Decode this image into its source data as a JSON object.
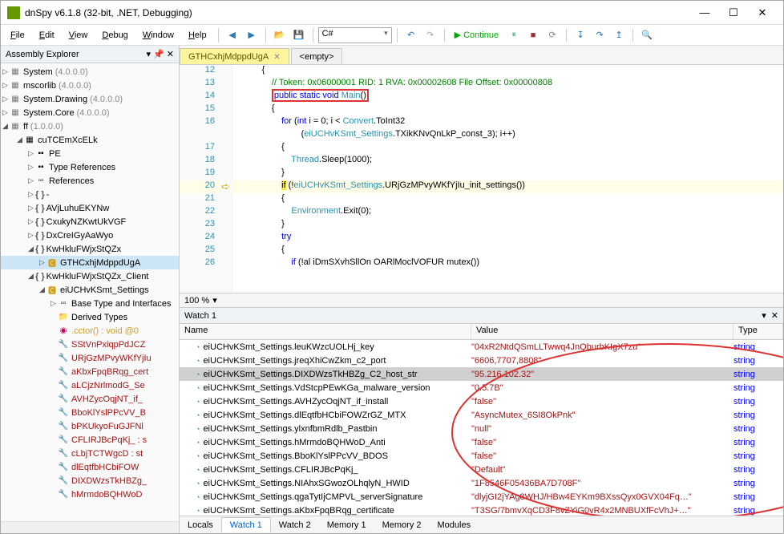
{
  "window": {
    "title": "dnSpy v6.1.8 (32-bit, .NET, Debugging)"
  },
  "menu": {
    "file": "File",
    "edit": "Edit",
    "view": "View",
    "debug": "Debug",
    "window": "Window",
    "help": "Help"
  },
  "toolbar": {
    "language": "C#",
    "continue": "Continue"
  },
  "explorer": {
    "title": "Assembly Explorer",
    "roots": [
      {
        "name": "System",
        "ver": "(4.0.0.0)"
      },
      {
        "name": "mscorlib",
        "ver": "(4.0.0.0)"
      },
      {
        "name": "System.Drawing",
        "ver": "(4.0.0.0)"
      },
      {
        "name": "System.Core",
        "ver": "(4.0.0.0)"
      },
      {
        "name": "ff",
        "ver": "(1.0.0.0)"
      }
    ],
    "sub": [
      {
        "name": "cuTCEmXcELk"
      },
      {
        "name": "PE",
        "icon": "pe"
      },
      {
        "name": "Type References",
        "icon": "pe"
      },
      {
        "name": "References",
        "icon": "ref"
      },
      {
        "name": "{ } -"
      },
      {
        "name": "{ } AVjLuhuEKYNw"
      },
      {
        "name": "{ } CxukyNZKwtUkVGF"
      },
      {
        "name": "{ } DxCreIGyAaWyo"
      },
      {
        "name": "{ } KwHkluFWjxStQZx"
      },
      {
        "name": "GTHCxhjMdppdUgA",
        "icon": "cls",
        "selected": true
      },
      {
        "name": "{ } KwHkluFWjxStQZx_Client"
      },
      {
        "name": "eiUCHvKSmt_Settings",
        "icon": "cls"
      },
      {
        "name": "Base Type and Interfaces",
        "icon": "ref"
      },
      {
        "name": "Derived Types",
        "icon": "folder"
      },
      {
        "name": ".cctor() : void @0",
        "icon": "method"
      },
      {
        "name": "SStVnPxiqpPdJCZ",
        "icon": "prop"
      },
      {
        "name": "URjGzMPvyWKfYjIu",
        "icon": "prop"
      },
      {
        "name": "aKbxFpqBRqg_cert",
        "icon": "prop"
      },
      {
        "name": "aLCjzNrlmodG_Se",
        "icon": "prop"
      },
      {
        "name": "AVHZycOqjNT_if_",
        "icon": "prop"
      },
      {
        "name": "BboKlYslPPcVV_B",
        "icon": "prop"
      },
      {
        "name": "bPKUkyoFuGJFNl",
        "icon": "prop"
      },
      {
        "name": "CFLIRJBcPqKj_ : s",
        "icon": "prop"
      },
      {
        "name": "cLbjTCTWgcD : st",
        "icon": "prop"
      },
      {
        "name": "dlEqtfbHCbiFOW",
        "icon": "prop"
      },
      {
        "name": "DIXDWzsTkHBZg_",
        "icon": "prop"
      },
      {
        "name": "hMrmdoBQHWoD",
        "icon": "prop"
      }
    ]
  },
  "editor": {
    "tabs": [
      {
        "label": "GTHCxhjMdppdUgA",
        "active": true
      },
      {
        "label": "<empty>"
      }
    ],
    "zoom": "100 %",
    "lines": [
      {
        "n": 12,
        "i": 3,
        "txt": "{"
      },
      {
        "n": 13,
        "i": 4,
        "seg": [
          [
            "cm",
            "// Token: 0x06000001 RID: 1 RVA: 0x00002608 File Offset: 0x00000808"
          ]
        ]
      },
      {
        "n": 14,
        "i": 4,
        "box": true,
        "seg": [
          [
            "kw",
            "public static void"
          ],
          [
            "",
            " "
          ],
          [
            "ty",
            "Main"
          ],
          [
            "",
            "()"
          ]
        ]
      },
      {
        "n": 15,
        "i": 4,
        "txt": "{"
      },
      {
        "n": 16,
        "i": 5,
        "seg": [
          [
            "kw",
            "for"
          ],
          [
            "",
            " ("
          ],
          [
            "kw",
            "int"
          ],
          [
            "",
            " i = "
          ],
          [
            "num",
            "0"
          ],
          [
            "",
            "; i < "
          ],
          [
            "ty",
            "Convert"
          ],
          [
            "",
            ".ToInt32"
          ]
        ]
      },
      {
        "n": null,
        "i": 7,
        "seg": [
          [
            "",
            "("
          ],
          [
            "ty",
            "eiUCHvKSmt_Settings"
          ],
          [
            "",
            ".TXikKNvQnLkP_const_3); i++)"
          ]
        ]
      },
      {
        "n": 17,
        "i": 5,
        "txt": "{"
      },
      {
        "n": 18,
        "i": 6,
        "seg": [
          [
            "ty",
            "Thread"
          ],
          [
            "",
            ".Sleep("
          ],
          [
            "num",
            "1000"
          ],
          [
            "",
            ");"
          ]
        ]
      },
      {
        "n": 19,
        "i": 5,
        "txt": "}"
      },
      {
        "n": 20,
        "i": 5,
        "arrow": true,
        "hl": true,
        "seg": [
          [
            "hl-if",
            "if"
          ],
          [
            "",
            " (!"
          ],
          [
            "ty",
            "eiUCHvKSmt_Settings"
          ],
          [
            "",
            ".URjGzMPvyWKfYjIu_init_settings())"
          ]
        ]
      },
      {
        "n": 21,
        "i": 5,
        "txt": "{"
      },
      {
        "n": 22,
        "i": 6,
        "seg": [
          [
            "ty",
            "Environment"
          ],
          [
            "",
            ".Exit("
          ],
          [
            "num",
            "0"
          ],
          [
            "",
            ");"
          ]
        ]
      },
      {
        "n": 23,
        "i": 5,
        "txt": "}"
      },
      {
        "n": 24,
        "i": 5,
        "seg": [
          [
            "kw",
            "try"
          ]
        ]
      },
      {
        "n": 25,
        "i": 5,
        "txt": "{"
      },
      {
        "n": 26,
        "i": 6,
        "seg": [
          [
            "kw",
            "if"
          ],
          [
            "",
            " (!al iDmSXvhSllOn OARlMoclVOFUR mutex())"
          ]
        ]
      }
    ]
  },
  "watch": {
    "title": "Watch 1",
    "cols": {
      "name": "Name",
      "value": "Value",
      "type": "Type"
    },
    "rows": [
      {
        "n": "eiUCHvKSmt_Settings.leuKWzcUOLHj_key",
        "v": "\"04xR2NtdQSmLLTwwq4JnQburbKIgX7zu\"",
        "t": "string"
      },
      {
        "n": "eiUCHvKSmt_Settings.jreqXhiCwZkm_c2_port",
        "v": "\"6606,7707,8808\"",
        "t": "string"
      },
      {
        "n": "eiUCHvKSmt_Settings.DIXDWzsTkHBZg_C2_host_str",
        "v": "\"95.216.102.32\"",
        "t": "string",
        "sel": true
      },
      {
        "n": "eiUCHvKSmt_Settings.VdStcpPEwKGa_malware_version",
        "v": "\"0.5.7B\"",
        "t": "string"
      },
      {
        "n": "eiUCHvKSmt_Settings.AVHZycOqjNT_if_install",
        "v": "\"false\"",
        "t": "string"
      },
      {
        "n": "eiUCHvKSmt_Settings.dlEqtfbHCbiFOWZrGZ_MTX",
        "v": "\"AsyncMutex_6SI8OkPnk\"",
        "t": "string"
      },
      {
        "n": "eiUCHvKSmt_Settings.ylxnfbmRdlb_Pastbin",
        "v": "\"null\"",
        "t": "string"
      },
      {
        "n": "eiUCHvKSmt_Settings.hMrmdoBQHWoD_Anti",
        "v": "\"false\"",
        "t": "string"
      },
      {
        "n": "eiUCHvKSmt_Settings.BboKlYslPPcVV_BDOS",
        "v": "\"false\"",
        "t": "string"
      },
      {
        "n": "eiUCHvKSmt_Settings.CFLIRJBcPqKj_",
        "v": "\"Default\"",
        "t": "string"
      },
      {
        "n": "eiUCHvKSmt_Settings.NIAhxSGwozOLhqlyN_HWID",
        "v": "\"1F8546F05436BA7D708F\"",
        "t": "string"
      },
      {
        "n": "eiUCHvKSmt_Settings.qgaTytIjCMPVL_serverSignature",
        "v": "\"dlyjGI2jYAg8WHJ/HBw4EYKm9BXssQyx0GVX04Fq…\"",
        "t": "string"
      },
      {
        "n": "eiUCHvKSmt_Settings.aKbxFpqBRqg_certificate",
        "v": "\"T3SG/7bmvXqCD3F8vZYiG0vR4x2MNBUXfFcVhJ+…\"",
        "t": "string"
      }
    ],
    "tabs": [
      "Locals",
      "Watch 1",
      "Watch 2",
      "Memory 1",
      "Memory 2",
      "Modules"
    ]
  }
}
